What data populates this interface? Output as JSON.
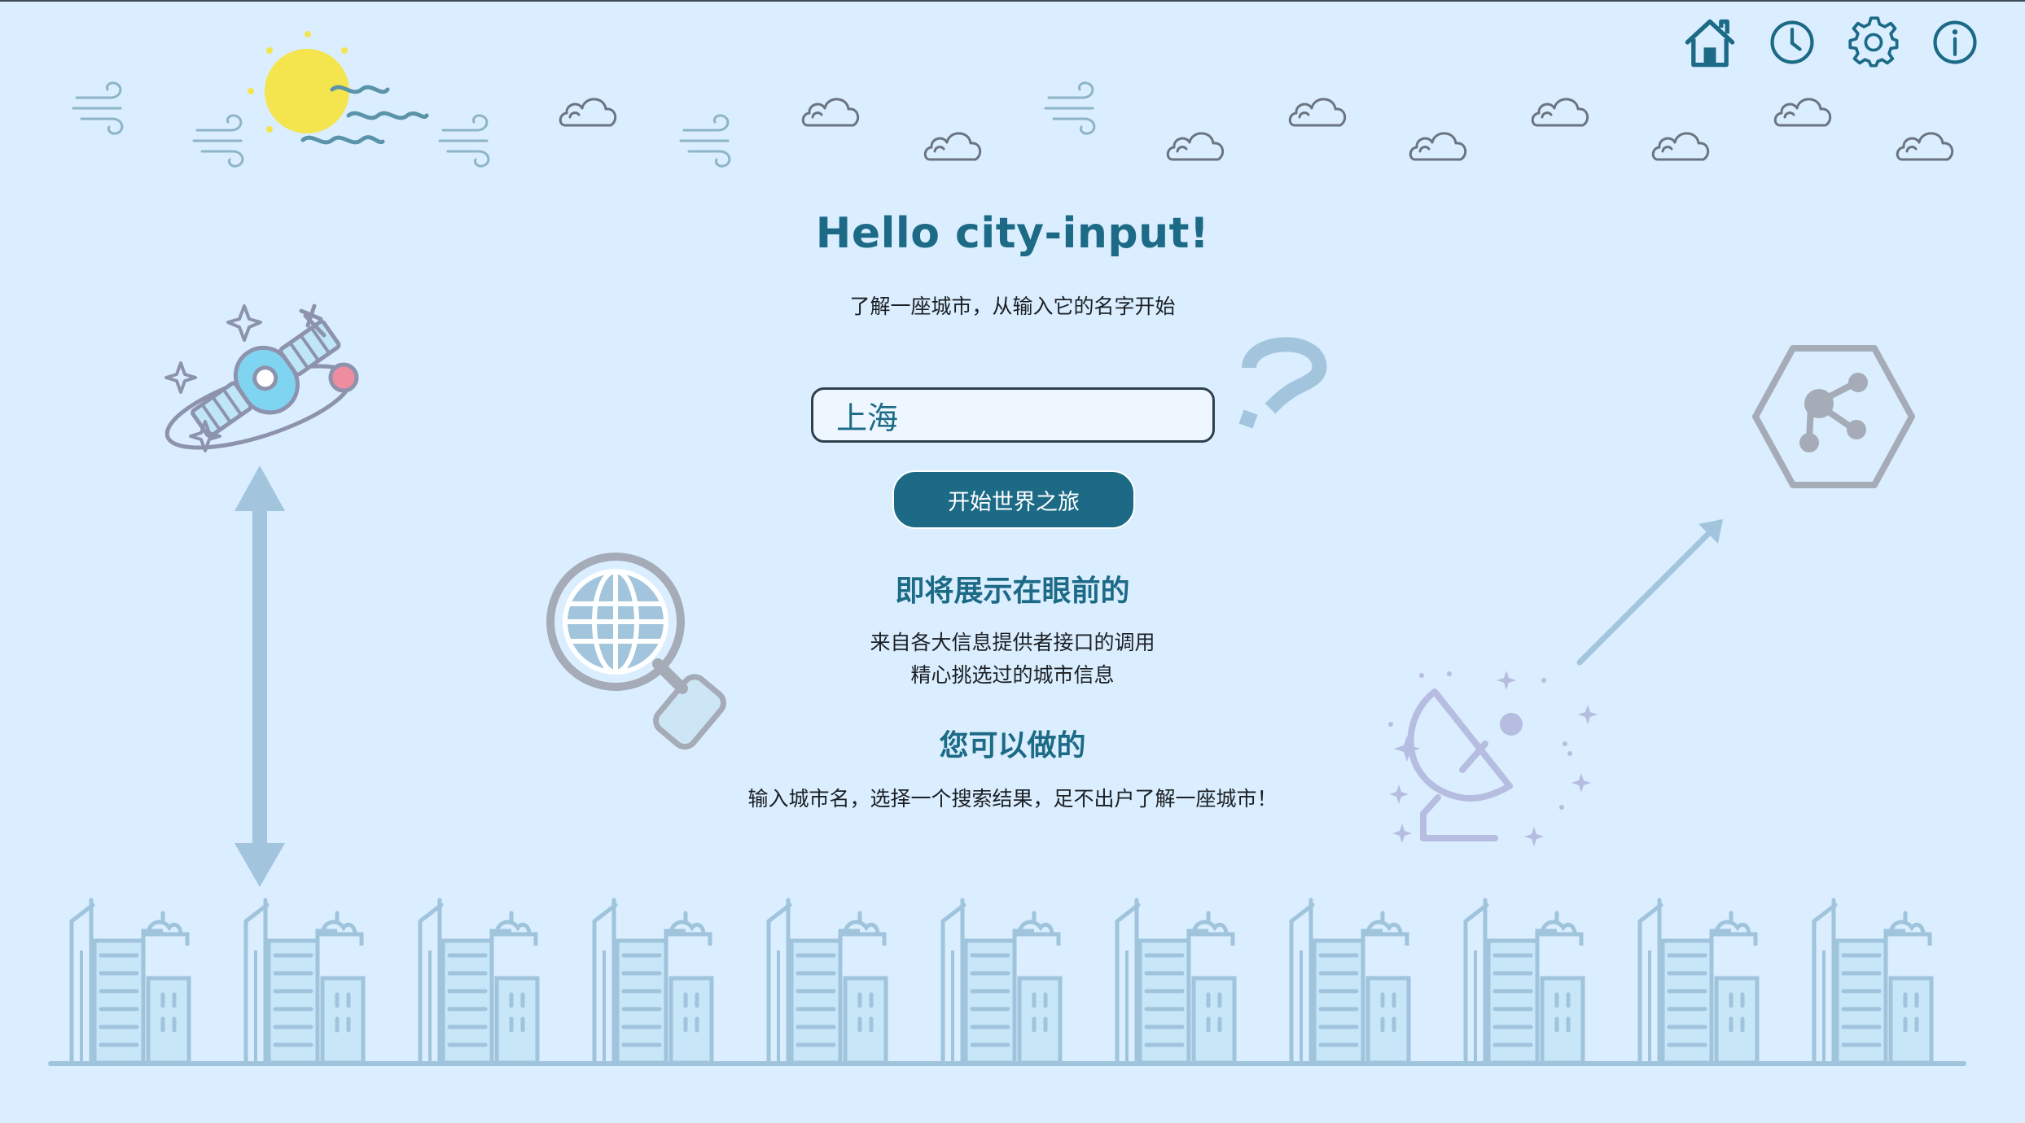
{
  "page": {
    "title": "Hello city-input!",
    "subtitle": "了解一座城市，从输入它的名字开始"
  },
  "toolbar": {
    "home_icon": "home-icon",
    "history_icon": "clock-icon",
    "settings_icon": "gear-icon",
    "about_icon": "info-icon"
  },
  "search": {
    "value": "上海",
    "placeholder": ""
  },
  "start_button": {
    "label": "开始世界之旅"
  },
  "section_preview": {
    "heading": "即将展示在眼前的",
    "line1": "来自各大信息提供者接口的调用",
    "line2": "精心挑选过的城市信息"
  },
  "section_actions": {
    "heading": "您可以做的",
    "line1": "输入城市名，选择一个搜索结果，足不出户了解一座城市！"
  },
  "colors": {
    "background": "#daeeff",
    "accent": "#1c6a86",
    "input_border": "#2e3f4d",
    "decor_blue": "#9fc4dc",
    "decor_grey": "#a4aab6",
    "sun": "#f4e44e"
  }
}
